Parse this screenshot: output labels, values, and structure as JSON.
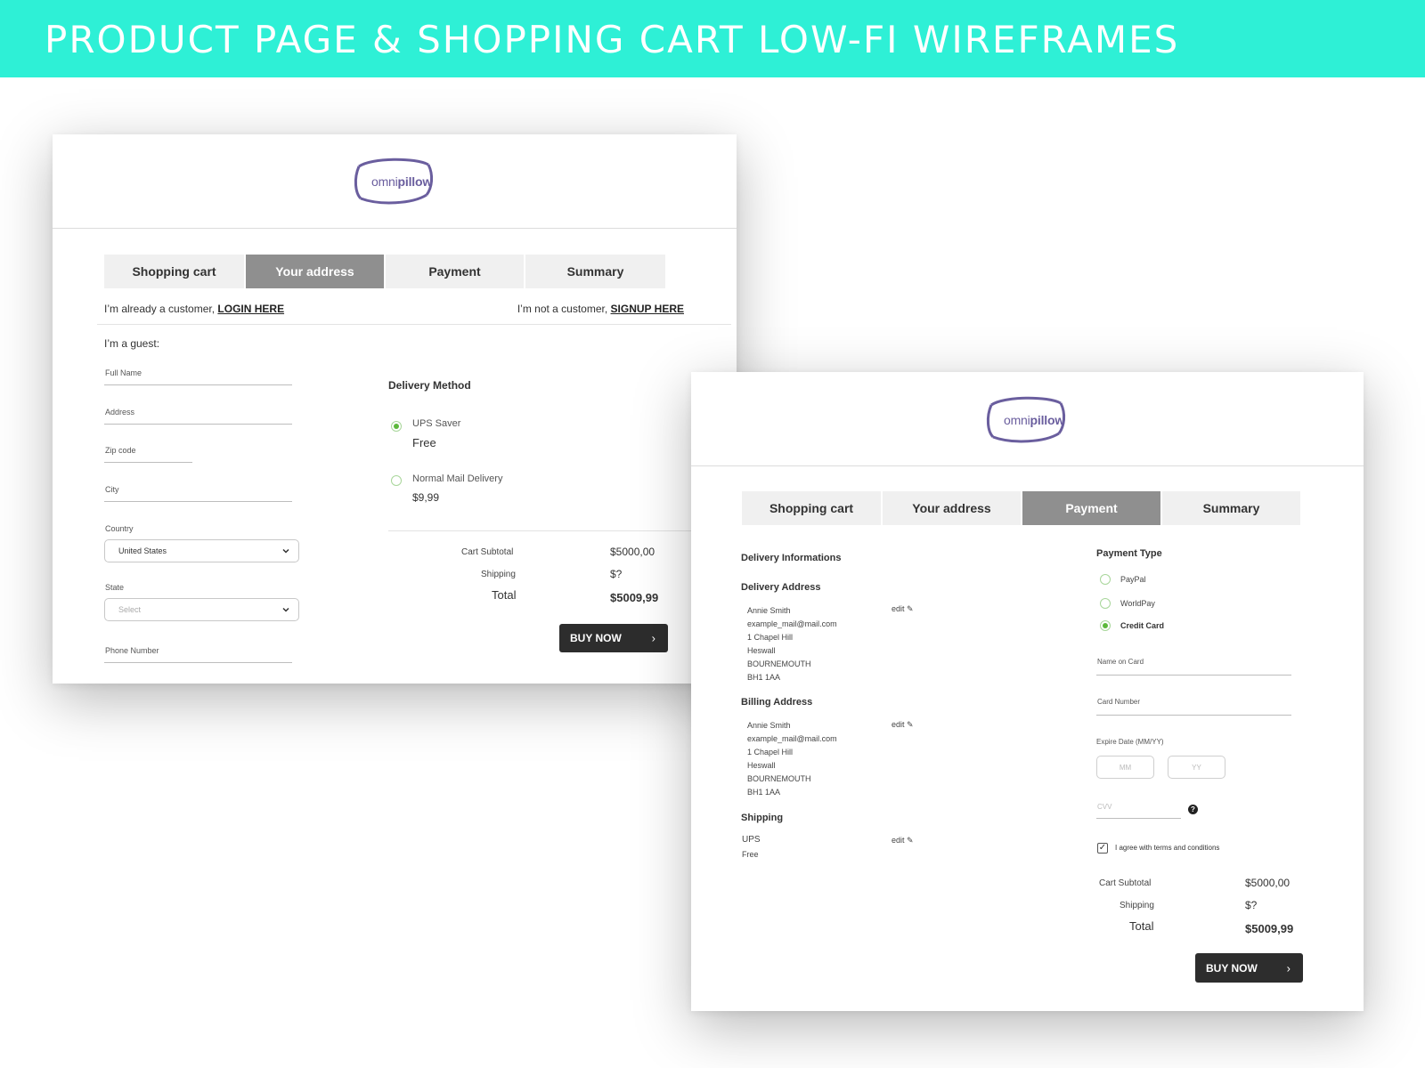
{
  "banner": {
    "title": "PRODUCT PAGE & SHOPPING CART LOW-FI WIREFRAMES"
  },
  "brand": {
    "logo_light": "omni",
    "logo_bold": "pillow",
    "color": "#6a5e9e"
  },
  "colors": {
    "accent_banner": "#2ef0d6",
    "active_tab": "#8f8f8f",
    "radio_on": "#5cb83b",
    "buy_button": "#2d2d2d"
  },
  "address_screen": {
    "tabs": [
      "Shopping cart",
      "Your address",
      "Payment",
      "Summary"
    ],
    "active_tab": "Your address",
    "login_prefix": "I’m already a customer,",
    "login_link": "LOGIN HERE",
    "signup_prefix": "I’m not a customer,",
    "signup_link": "SIGNUP HERE",
    "guest_label": "I’m a guest:",
    "fields": {
      "full_name": "Full Name",
      "address": "Address",
      "zip": "Zip code",
      "city": "City",
      "country": "Country",
      "country_value": "United States",
      "state": "State",
      "state_placeholder": "Select",
      "phone": "Phone Number"
    },
    "delivery": {
      "title": "Delivery Method",
      "options": [
        {
          "name": "UPS Saver",
          "price": "Free",
          "selected": true
        },
        {
          "name": "Normal Mail Delivery",
          "price": "$9,99",
          "selected": false
        }
      ]
    },
    "totals": {
      "subtotal_label": "Cart Subtotal",
      "subtotal": "$5000,00",
      "shipping_label": "Shipping",
      "shipping": "$?",
      "total_label": "Total",
      "total": "$5009,99"
    },
    "buy_label": "BUY NOW"
  },
  "payment_screen": {
    "tabs": [
      "Shopping cart",
      "Your address",
      "Payment",
      "Summary"
    ],
    "active_tab": "Payment",
    "delivery_info_title": "Delivery Informations",
    "delivery_address": {
      "title": "Delivery Address",
      "lines": [
        "Annie Smith",
        "example_mail@mail.com",
        "1 Chapel Hill",
        "Heswall",
        "BOURNEMOUTH",
        "BH1 1AA"
      ],
      "edit": "edit"
    },
    "billing_address": {
      "title": "Billing Address",
      "lines": [
        "Annie Smith",
        "example_mail@mail.com",
        "1 Chapel Hill",
        "Heswall",
        "BOURNEMOUTH",
        "BH1 1AA"
      ],
      "edit": "edit"
    },
    "shipping": {
      "title": "Shipping",
      "method": "UPS",
      "price": "Free",
      "edit": "edit"
    },
    "payment_type": {
      "title": "Payment Type",
      "options": [
        {
          "name": "PayPal",
          "selected": false
        },
        {
          "name": "WorldPay",
          "selected": false
        },
        {
          "name": "Credit Card",
          "selected": true
        }
      ]
    },
    "card": {
      "name_label": "Name on Card",
      "number_label": "Card Number",
      "expire_label": "Expire Date (MM/YY)",
      "mm_placeholder": "MM",
      "yy_placeholder": "YY",
      "cvv_placeholder": "CVV",
      "help_glyph": "?"
    },
    "terms_label": "I agree with terms and conditions",
    "terms_checked": true,
    "totals": {
      "subtotal_label": "Cart Subtotal",
      "subtotal": "$5000,00",
      "shipping_label": "Shipping",
      "shipping": "$?",
      "total_label": "Total",
      "total": "$5009,99"
    },
    "buy_label": "BUY NOW"
  }
}
